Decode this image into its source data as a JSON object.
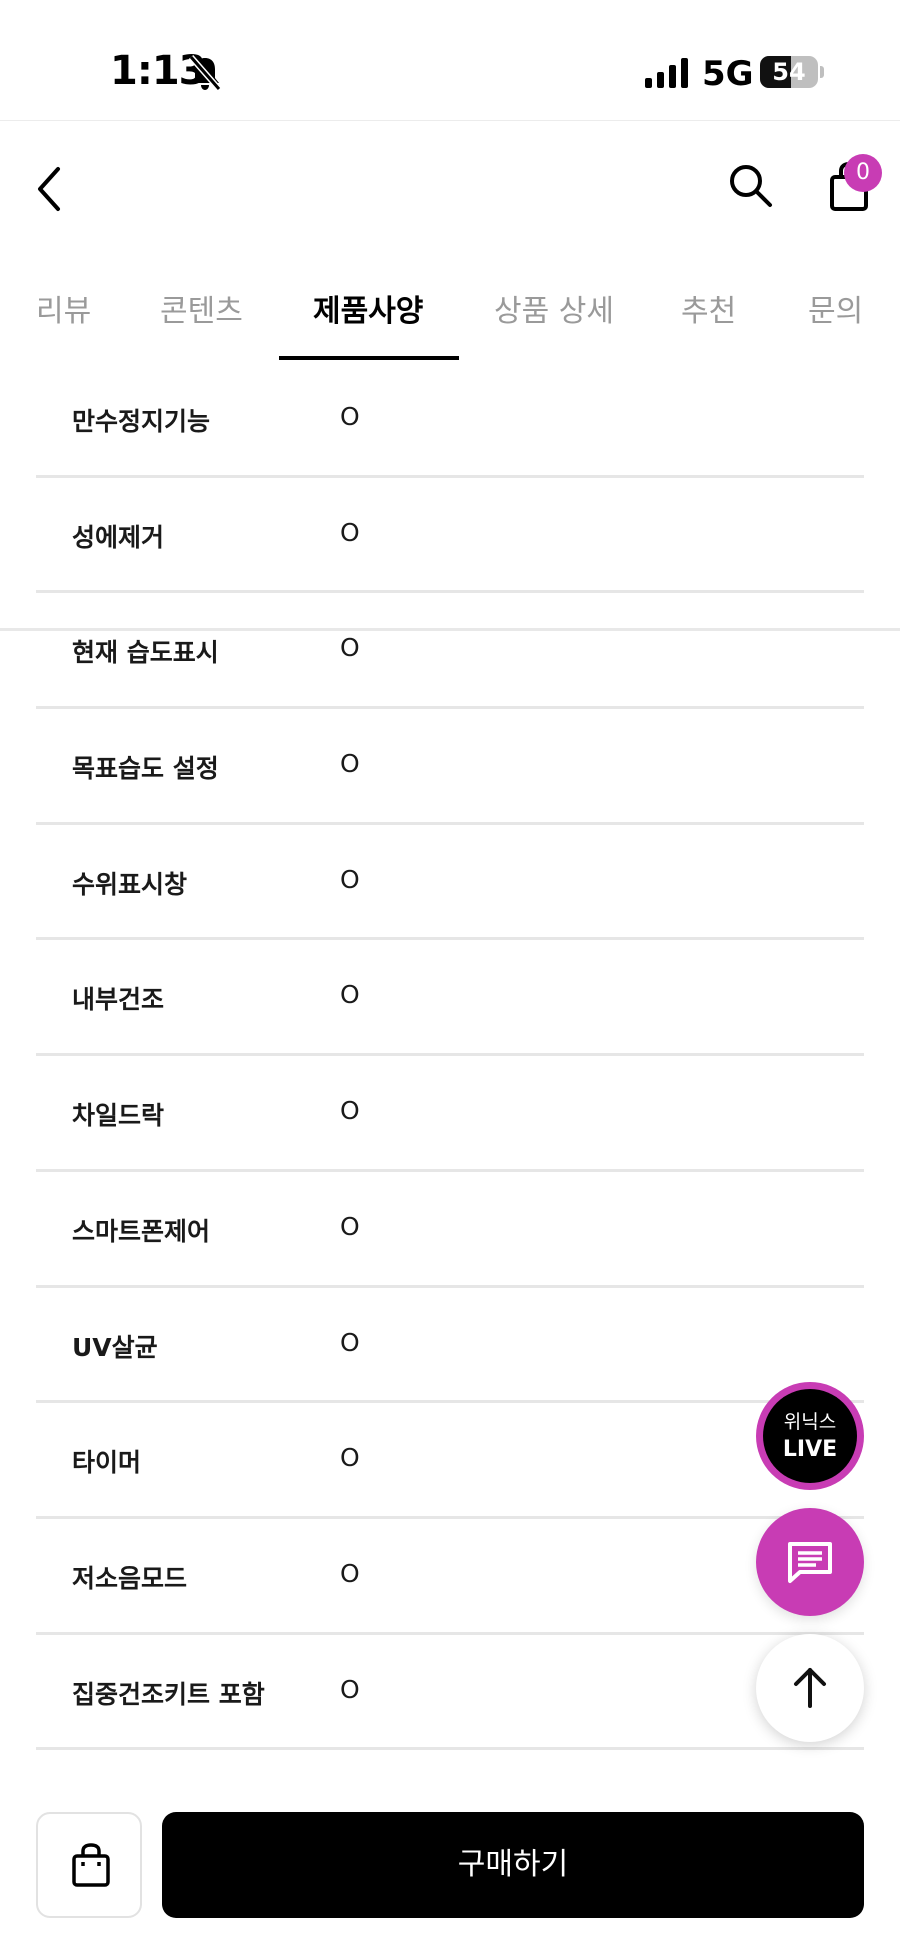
{
  "status_bar": {
    "time": "1:13",
    "network": "5G",
    "battery": "54",
    "battery_level": 0.54
  },
  "header": {
    "cart_count": "0"
  },
  "tabs": [
    {
      "label": "리뷰",
      "active": false
    },
    {
      "label": "콘텐츠",
      "active": false
    },
    {
      "label": "제품사양",
      "active": true
    },
    {
      "label": "상품 상세",
      "active": false
    },
    {
      "label": "추천",
      "active": false
    },
    {
      "label": "문의",
      "active": false
    }
  ],
  "specs": [
    {
      "label": "만수정지기능",
      "value": "O"
    },
    {
      "label": "성에제거",
      "value": "O"
    },
    {
      "label": "현재 습도표시",
      "value": "O"
    },
    {
      "label": "목표습도 설정",
      "value": "O"
    },
    {
      "label": "수위표시창",
      "value": "O"
    },
    {
      "label": "내부건조",
      "value": "O"
    },
    {
      "label": "차일드락",
      "value": "O"
    },
    {
      "label": "스마트폰제어",
      "value": "O"
    },
    {
      "label": "UV살균",
      "value": "O"
    },
    {
      "label": "타이머",
      "value": "O"
    },
    {
      "label": "저소음모드",
      "value": "O"
    },
    {
      "label": "집중건조키트 포함",
      "value": "O"
    }
  ],
  "floating": {
    "live_top": "위닉스",
    "live_bottom": "LIVE"
  },
  "bottom_bar": {
    "buy_label": "구매하기"
  },
  "colors": {
    "accent": "#c83cb4",
    "primary_button": "#000000",
    "inactive_tab": "#9a9a9a"
  },
  "icons": [
    "bell-slash-icon",
    "signal-icon",
    "back-arrow-icon",
    "search-icon",
    "cart-icon",
    "chat-icon",
    "arrow-up-icon",
    "shopping-bag-icon"
  ]
}
